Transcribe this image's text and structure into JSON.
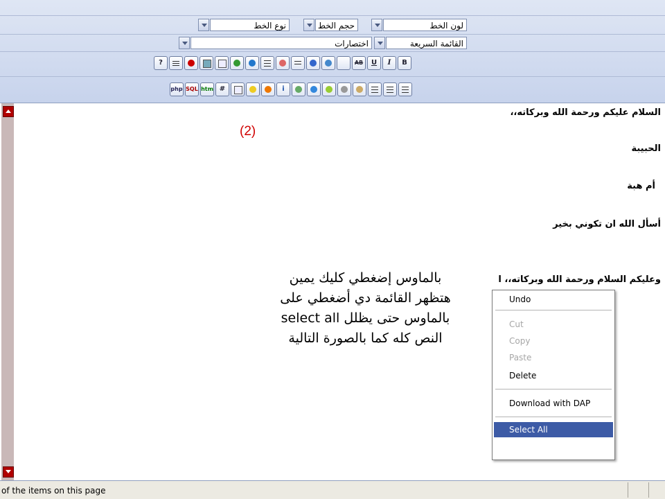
{
  "toolbar": {
    "font_color_label": "لون الخط",
    "font_size_label": "حجم الخط",
    "font_type_label": "نوع الخط",
    "quick_list_label": "القائمة السريعة",
    "shortcuts_label": "اختصارات",
    "row3_icons": [
      "help-icon",
      "document-icon",
      "flash-icon",
      "image-icon",
      "email-icon",
      "photo-icon",
      "globe-icon",
      "list-icon",
      "arrows-icon",
      "align-icon",
      "diamond-icon",
      "up-icon",
      "chevron-icon",
      "strike-icon",
      "underline-icon",
      "italic-icon",
      "bold-icon"
    ],
    "row4_icons": [
      "php-icon",
      "sql-icon",
      "htm-icon",
      "hash-icon",
      "table-icon",
      "smile-icon",
      "play-icon",
      "info-icon",
      "brush-icon",
      "move-icon",
      "bulb-icon",
      "dollar-icon",
      "dollar2-icon",
      "align-left-icon",
      "align-center-icon",
      "align-right-icon"
    ],
    "labels": {
      "help": "?",
      "bold": "B",
      "italic": "I",
      "underline": "U",
      "strike": "AB",
      "php": "php",
      "sql": "SQL",
      "htm": "htm",
      "hash": "#",
      "info": "i"
    },
    "accent": "#c7d3ec"
  },
  "editor": {
    "lines": [
      "السلام عليكم ورحمة الله وبركاته،،",
      "الحبيبة",
      "أم هبة",
      "أسأل الله ان تكوني بخير",
      "وعليكم السلام ورحمة الله وبركاته،، l"
    ],
    "step_label": "(2)",
    "instructions": [
      "بالماوس إضغطي كليك يمين",
      "هتظهر القائمة دي أضغطي على",
      "بالماوس حتى يظلل select all",
      "النص كله كما بالصورة التالية"
    ],
    "step_color": "#d00000"
  },
  "context_menu": {
    "items": [
      {
        "label": "Undo",
        "enabled": true
      },
      {
        "label": "Cut",
        "enabled": false
      },
      {
        "label": "Copy",
        "enabled": false
      },
      {
        "label": "Paste",
        "enabled": false
      },
      {
        "label": "Delete",
        "enabled": true
      },
      {
        "label": "Download with DAP",
        "enabled": true
      },
      {
        "label": "Select All",
        "enabled": true,
        "selected": true
      }
    ],
    "selection_color": "#3d5ba6"
  },
  "status_bar": {
    "text": "of the items on this page"
  }
}
